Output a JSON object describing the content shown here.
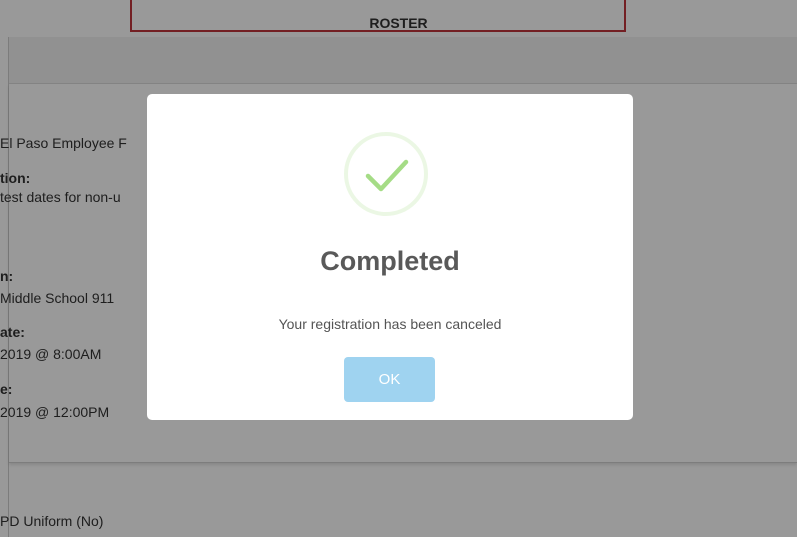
{
  "page": {
    "header_title": "ROSTER",
    "details": [
      {
        "text": "El Paso Employee F",
        "bold": false
      },
      {
        "text": "tion:",
        "bold": true
      },
      {
        "text": "test dates for non-u",
        "bold": false
      },
      {
        "text": "n:",
        "bold": true
      },
      {
        "text": "Middle School 911",
        "bold": false
      },
      {
        "text": "ate:",
        "bold": true
      },
      {
        "text": "2019 @ 8:00AM",
        "bold": false
      },
      {
        "text": "e:",
        "bold": true
      },
      {
        "text": "2019 @ 12:00PM",
        "bold": false
      }
    ],
    "lower_text": "PD Uniform (No)"
  },
  "modal": {
    "icon": "checkmark-circle-icon",
    "title": "Completed",
    "message": "Your registration has been canceled",
    "ok_label": "OK"
  },
  "colors": {
    "success": "#a5dc86",
    "ok_button": "#9fd3f0",
    "top_border": "#c0343b"
  }
}
